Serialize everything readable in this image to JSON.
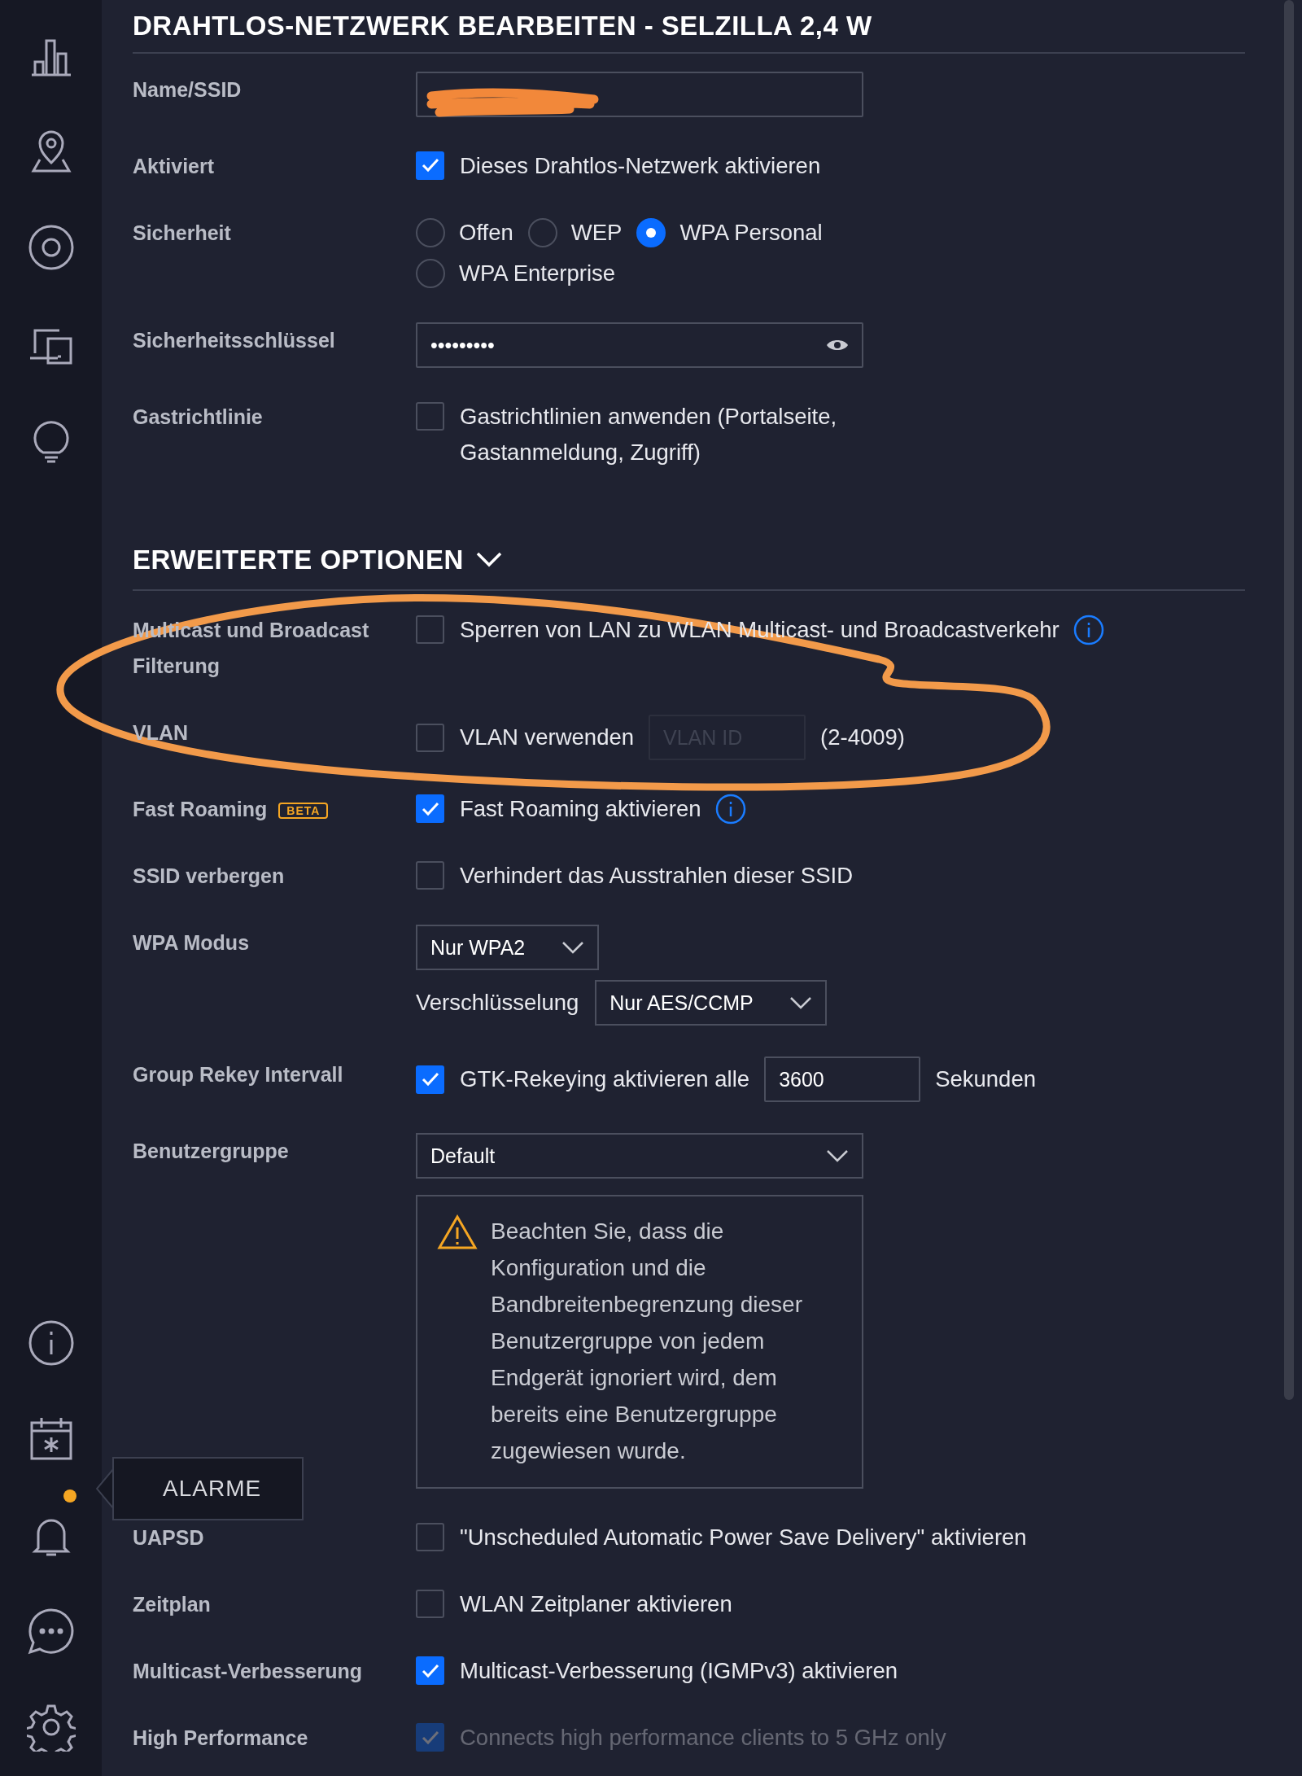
{
  "title": "DRAHTLOS-NETZWERK BEARBEITEN - SELZILLA 2,4 W",
  "rows": [
    {
      "kind": "redacted",
      "label": "Name/SSID"
    },
    {
      "kind": "checkbox",
      "label": "Aktiviert",
      "checked": true,
      "text": "Dieses Drahtlos-Netzwerk aktivieren"
    },
    {
      "kind": "radio",
      "label": "Sicherheit",
      "options": [
        {
          "text": "Offen",
          "selected": false
        },
        {
          "text": "WEP",
          "selected": false
        },
        {
          "text": "WPA Personal",
          "selected": true
        },
        {
          "text": "WPA Enterprise",
          "selected": false
        }
      ]
    },
    {
      "kind": "password",
      "label": "Sicherheitsschlüssel",
      "value": "•••••••••"
    },
    {
      "kind": "checkbox",
      "label": "Gastrichtlinie",
      "checked": false,
      "text": "Gastrichtlinien anwenden (Portalseite, Gastanmeldung, Zugriff)"
    }
  ],
  "advanced": {
    "title": "ERWEITERTE OPTIONEN",
    "expanded": true,
    "rows": [
      {
        "kind": "checkbox",
        "label": "Multicast und Broadcast Filterung",
        "checked": false,
        "text": "Sperren von LAN zu WLAN Multicast- und Broadcastverkehr",
        "info": true
      },
      {
        "kind": "vlan",
        "label": "VLAN",
        "checked": false,
        "text": "VLAN verwenden",
        "placeholder": "VLAN ID",
        "hint": "(2-4009)"
      },
      {
        "kind": "checkbox",
        "label": "Fast Roaming",
        "badge": "BETA",
        "checked": true,
        "text": "Fast Roaming aktivieren",
        "info": true
      },
      {
        "kind": "checkbox",
        "label": "SSID verbergen",
        "checked": false,
        "text": "Verhindert das Ausstrahlen dieser SSID"
      },
      {
        "kind": "wpa",
        "label": "WPA Modus",
        "value": "Nur WPA2",
        "sublabel": "Verschlüsselung",
        "subvalue": "Nur AES/CCMP"
      },
      {
        "kind": "rekey",
        "label": "Group Rekey Intervall",
        "checked": true,
        "text": "GTK-Rekeying aktivieren alle",
        "value": "3600",
        "unit": "Sekunden"
      },
      {
        "kind": "usergroup",
        "label": "Benutzergruppe",
        "value": "Default",
        "note": "Beachten Sie, dass die Konfiguration und die Bandbreitenbegrenzung dieser Benutzergruppe von jedem Endgerät ignoriert wird, dem bereits eine Benutzergruppe zugewiesen wurde."
      },
      {
        "kind": "checkbox",
        "label": "UAPSD",
        "checked": false,
        "text": "\"Unscheduled Automatic Power Save Delivery\" aktivieren"
      },
      {
        "kind": "checkbox",
        "label": "Zeitplan",
        "checked": false,
        "text": "WLAN Zeitplaner aktivieren"
      },
      {
        "kind": "checkbox",
        "label": "Multicast-Verbesserung",
        "checked": true,
        "text": "Multicast-Verbesserung (IGMPv3) aktivieren"
      },
      {
        "kind": "checkbox",
        "label": "High Performance",
        "checked": true,
        "disabled": true,
        "text": "Connects high performance clients to 5 GHz only"
      }
    ]
  },
  "tooltip": {
    "text": "ALARME"
  },
  "alarm_dot": {
    "color": "#f5a623"
  }
}
